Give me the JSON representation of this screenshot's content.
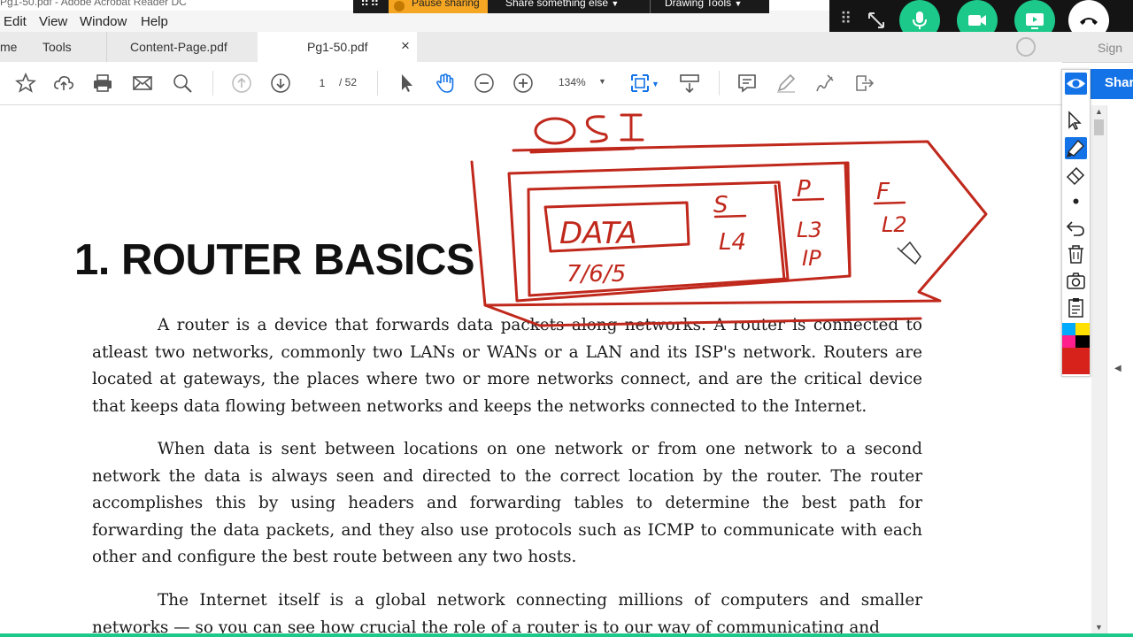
{
  "window": {
    "title": "Pg1-50.pdf - Adobe Acrobat Reader DC"
  },
  "menu": {
    "items": [
      "Edit",
      "View",
      "Window",
      "Help"
    ]
  },
  "share_bar": {
    "pause_label": "Pause sharing",
    "share_else_label": "Share something else",
    "drawing_tools_label": "Drawing Tools"
  },
  "tabs": {
    "home": "me",
    "tools": "Tools",
    "tab1": "Content-Page.pdf",
    "tab2": "Pg1-50.pdf",
    "close_glyph": "×"
  },
  "toolbar": {
    "current_page": "1",
    "total_pages": "/ 52",
    "zoom": "134%"
  },
  "right_panel": {
    "share_label": "Shar",
    "sign_label": "Sign"
  },
  "document": {
    "heading": "1. ROUTER BASICS",
    "paragraphs": [
      "A router is a device that forwards data packets along networks. A router is connected to atleast two networks, commonly two LANs or WANs or a LAN and its ISP's network. Routers are located at gateways, the places where two or more networks connect, and are the critical device that keeps data flowing between networks and keeps the networks connected to the Internet.",
      "When data is sent between locations on one network or from one network to a second network the data is always seen and directed to the correct location by the router. The router accomplishes this by using headers and forwarding tables to determine the best path for forwarding the data packets, and they also use protocols such as ICMP to communicate with each other and configure the best route between any two hosts.",
      "The Internet itself is a global network connecting millions of computers and smaller networks — so you can see how crucial the role of a router is to our way of communicating and"
    ]
  },
  "annotation_text": {
    "osi": "OSI",
    "data": "DATA",
    "layers_765": "7/6/5",
    "s": "S",
    "l4": "L4",
    "p": "P",
    "l3": "L3",
    "ip": "IP",
    "f": "F",
    "l2": "L2"
  },
  "colors": {
    "ink": "#c0281c",
    "brand_blue": "#1473e6",
    "call_green": "#1cc88a",
    "pause_orange": "#f5a623"
  },
  "icons": [
    "star-icon",
    "upload-icon",
    "print-icon",
    "mail-icon",
    "zoom-search-icon",
    "page-up-icon",
    "page-down-icon",
    "select-arrow-icon",
    "hand-icon",
    "zoom-out-icon",
    "zoom-in-icon",
    "fit-page-icon",
    "scroll-mode-icon",
    "comment-icon",
    "highlight-pen-icon",
    "sign-icon",
    "export-icon",
    "mic-icon",
    "camera-icon",
    "screen-share-icon",
    "end-call-icon",
    "expand-icon",
    "eye-icon",
    "cursor-icon",
    "marker-icon",
    "eraser-icon",
    "undo-icon",
    "trash-icon",
    "camera-snap-icon",
    "clipboard-icon",
    "color-palette-icon"
  ]
}
